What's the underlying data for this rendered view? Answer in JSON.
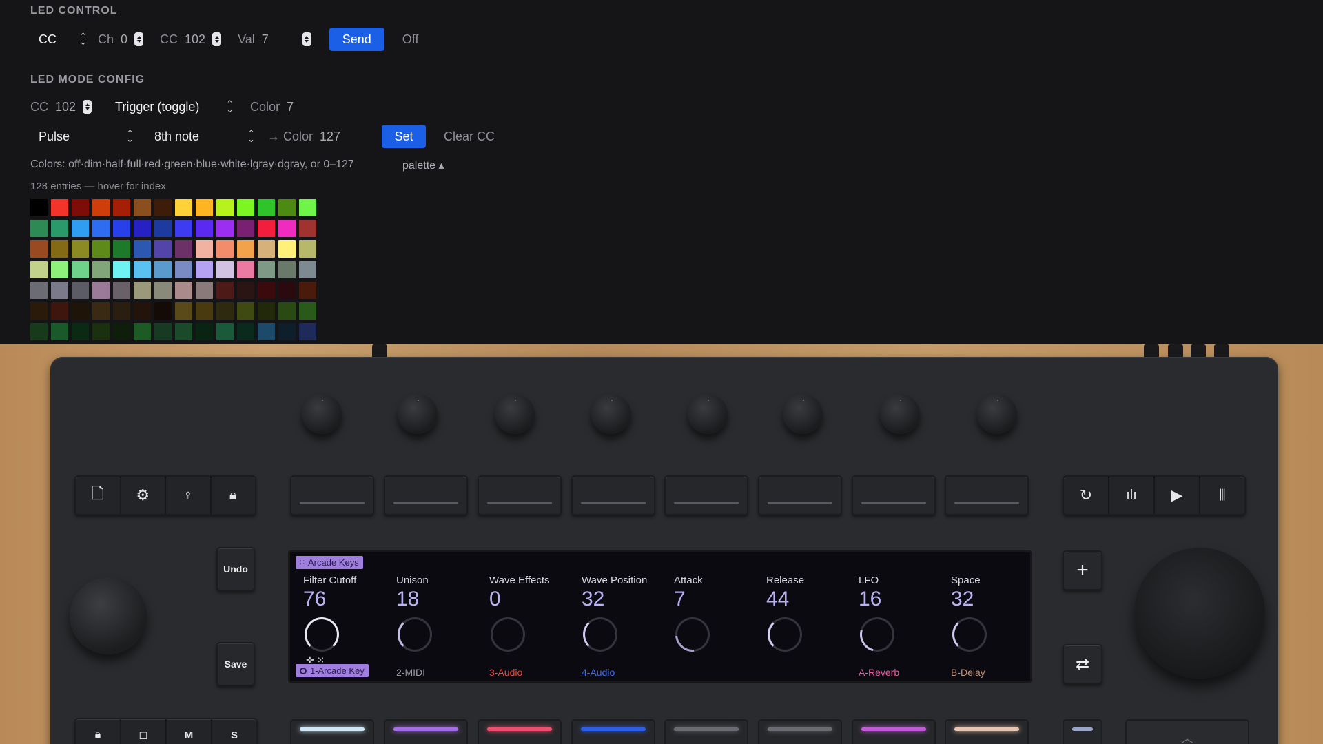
{
  "led_control": {
    "title": "LED CONTROL",
    "type_select": "CC",
    "ch_label": "Ch",
    "ch_value": "0",
    "cc_label": "CC",
    "cc_value": "102",
    "val_label": "Val",
    "val_value": "7",
    "send_label": "Send",
    "off_label": "Off"
  },
  "led_mode": {
    "title": "LED MODE CONFIG",
    "cc_label": "CC",
    "cc_value": "102",
    "trigger_select": "Trigger (toggle)",
    "color_label": "Color",
    "color_value": "7",
    "anim_select": "Pulse",
    "rate_select": "8th note",
    "to_color_label": "→ Color",
    "to_color_value": "127",
    "set_label": "Set",
    "clear_label": "Clear CC",
    "colors_hint": "Colors: off·dim·half·full·red·green·blue·white·lgray·dgray, or 0–127",
    "palette_toggle": "palette ▴",
    "entries_hint": "128 entries — hover for index"
  },
  "palette": [
    "#000000",
    "#f2342a",
    "#7e0c08",
    "#cf3e0a",
    "#a51f06",
    "#8a4f1f",
    "#3d1d0a",
    "#ffd23a",
    "#ffb521",
    "#b7f21c",
    "#7df522",
    "#2fc42a",
    "#4c8a12",
    "#6ff54a",
    "#2e8a54",
    "#2a9a6a",
    "#2f9df2",
    "#2e6cf2",
    "#2840ea",
    "#2521c2",
    "#1d3aa0",
    "#3e3cf2",
    "#5a2af2",
    "#9c2ef2",
    "#7a2072",
    "#f21e3c",
    "#f02cc0",
    "#a03230",
    "#9a4a20",
    "#846a14",
    "#8c8a22",
    "#5e8a1a",
    "#1c7a2a",
    "#2c58b2",
    "#5244a8",
    "#6c3268",
    "#f2b2a2",
    "#f28c6a",
    "#f2a24a",
    "#d6b27a",
    "#fff07a",
    "#b8b86a",
    "#c2d28a",
    "#8ef27a",
    "#6ed28a",
    "#80a67a",
    "#6ef2f2",
    "#5ac2f2",
    "#5a9acc",
    "#7a8ac2",
    "#b6a2f2",
    "#d2c2e2",
    "#ea7aa2",
    "#7e9a86",
    "#6a7a6a",
    "#7e8a92",
    "#6c6c74",
    "#7a7a8a",
    "#5c5c66",
    "#9a7a98",
    "#6a6068",
    "#9a9a7a",
    "#8a8a7a",
    "#aa8a8a",
    "#8a7a7a",
    "#4e1a18",
    "#2a1414",
    "#3a0a0c",
    "#2a0a0e",
    "#4a1a0a",
    "#2a1a0a",
    "#3e160e",
    "#1e1408",
    "#3a2a14",
    "#2a1e10",
    "#22140a",
    "#140a06",
    "#5a4a1a",
    "#4a3a10",
    "#2e2a10",
    "#3e4a12",
    "#22280a",
    "#2a4a14",
    "#2a5a1a",
    "#163a1a",
    "#1a5a2a",
    "#0a2a14",
    "#1a300e",
    "#0e1e0a",
    "#1e5a24",
    "#163a22",
    "#1a4a2a",
    "#0a2414",
    "#1a5a3a",
    "#0a2a1e",
    "#1e4a6a",
    "#0e1e2a",
    "#1e2a5a"
  ],
  "device": {
    "undo_label": "Undo",
    "save_label": "Save",
    "m_label": "M",
    "s_label": "S",
    "plus_label": "+",
    "screen": {
      "top_tag": "Arcade Keys",
      "bottom_tag": "1-Arcade Key",
      "params": [
        {
          "name": "Filter Cutoff",
          "value": "76"
        },
        {
          "name": "Unison",
          "value": "18"
        },
        {
          "name": "Wave Effects",
          "value": "0"
        },
        {
          "name": "Wave Position",
          "value": "32"
        },
        {
          "name": "Attack",
          "value": "7"
        },
        {
          "name": "Release",
          "value": "44"
        },
        {
          "name": "LFO",
          "value": "16"
        },
        {
          "name": "Space",
          "value": "32"
        }
      ],
      "tracks": [
        {
          "name": "2-MIDI",
          "color": "#9a9aa6"
        },
        {
          "name": "3-Audio",
          "color": "#f2463a"
        },
        {
          "name": "4-Audio",
          "color": "#3e6cf2"
        },
        {
          "name": "A-Reverb",
          "color": "#e85a9e"
        },
        {
          "name": "B-Delay",
          "color": "#c29272"
        }
      ]
    },
    "pad_colors": [
      "#cfe7f5",
      "#a66ee6",
      "#f04e6e",
      "#2c5ee8",
      "#6a6c72",
      "#6a6c72",
      "#c25ad8",
      "#e6c6b2"
    ]
  }
}
